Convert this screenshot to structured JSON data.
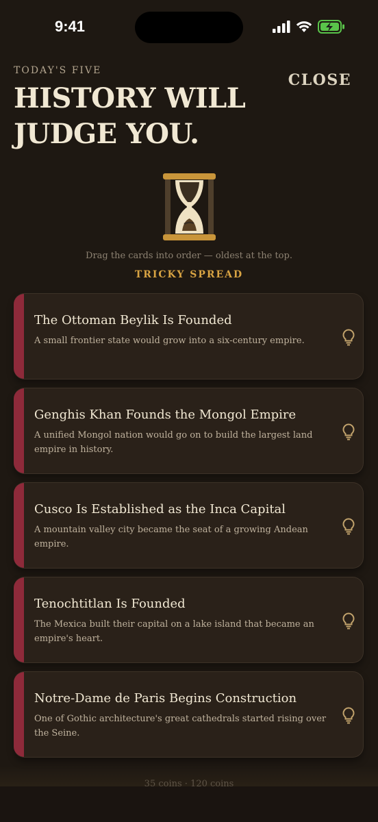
{
  "status_bar": {
    "time": "9:41"
  },
  "header": {
    "eyebrow": "TODAY'S FIVE",
    "title": "HISTORY WILL JUDGE YOU.",
    "close_label": "CLOSE"
  },
  "instructions": "Drag the cards into order — oldest at the top.",
  "difficulty": "TRICKY SPREAD",
  "cards": [
    {
      "title": "The Ottoman Beylik Is Founded",
      "description": "A small frontier state would grow into a six-century empire."
    },
    {
      "title": "Genghis Khan Founds the Mongol Empire",
      "description": "A unified Mongol nation would go on to build the largest land empire in history."
    },
    {
      "title": "Cusco Is Established as the Inca Capital",
      "description": "A mountain valley city became the seat of a growing Andean empire."
    },
    {
      "title": "Tenochtitlan Is Founded",
      "description": "The Mexica built their capital on a lake island that became an empire's heart."
    },
    {
      "title": "Notre-Dame de Paris Begins Construction",
      "description": "One of Gothic architecture's great cathedrals started rising over the Seine."
    }
  ],
  "footer": {
    "coins": "35 coins · 120 coins"
  },
  "icons": {
    "hint": "lightbulb-icon",
    "logo": "hourglass-icon"
  },
  "colors": {
    "background": "#1e1812",
    "card": "#2a2119",
    "accent_stripe": "#8e2a3a",
    "difficulty": "#d9a443",
    "hourglass_frame": "#c9953a"
  }
}
